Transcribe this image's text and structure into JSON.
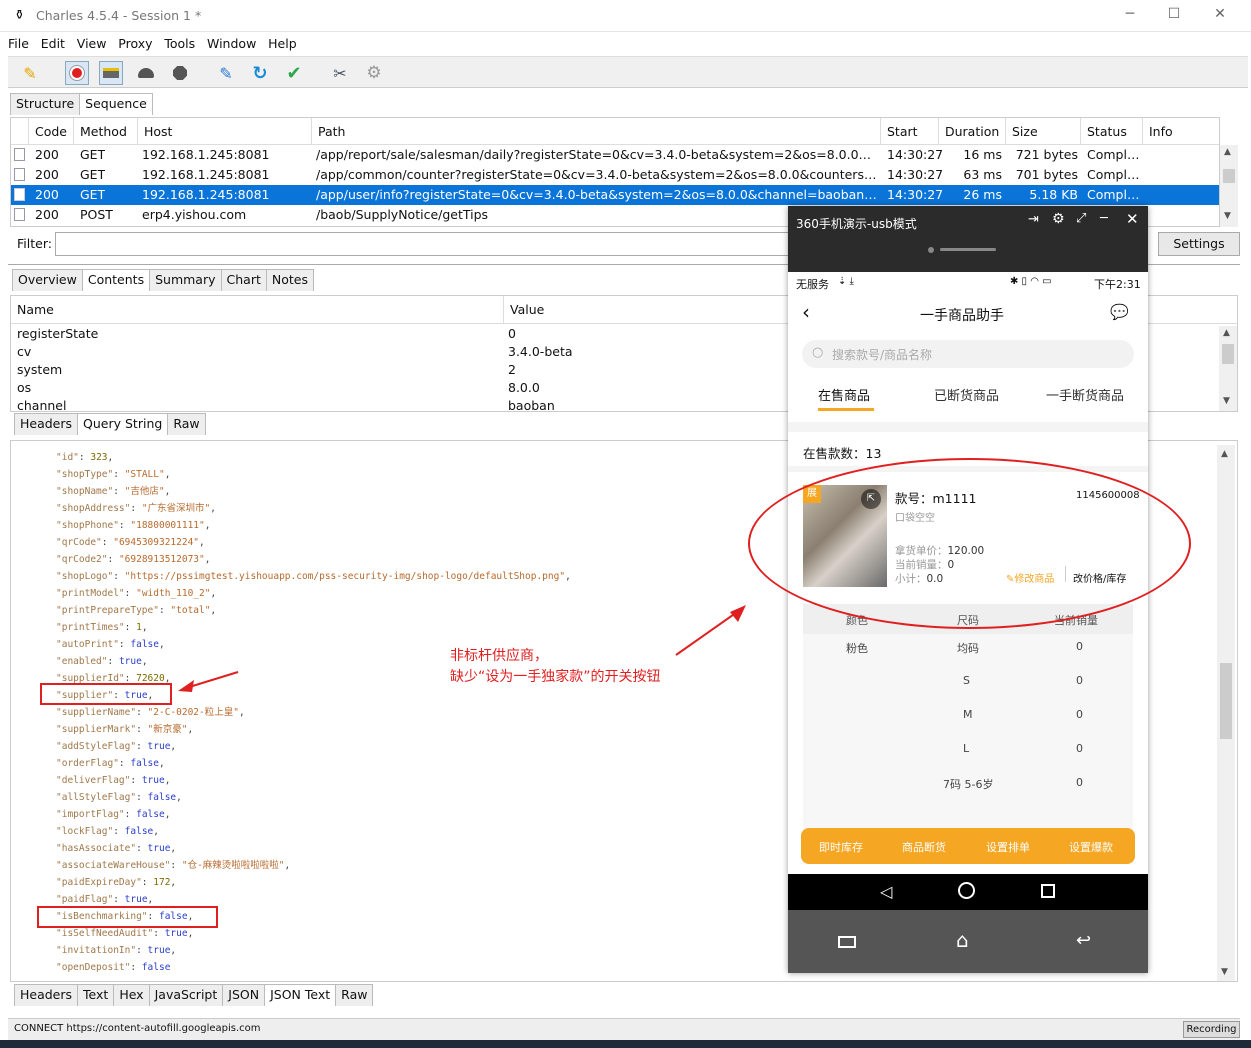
{
  "window": {
    "title": "Charles 4.5.4 - Session 1 *"
  },
  "menu": [
    "File",
    "Edit",
    "View",
    "Proxy",
    "Tools",
    "Window",
    "Help"
  ],
  "toolbar_icons": [
    "broom-icon",
    "record-icon",
    "throttle-icon",
    "turtle-icon",
    "stop-icon",
    "pen-icon",
    "refresh-icon",
    "check-icon",
    "tools-icon",
    "settings-icon"
  ],
  "view_tabs": [
    "Structure",
    "Sequence"
  ],
  "seq_headers": [
    "Code",
    "Method",
    "Host",
    "Path",
    "Start",
    "Duration",
    "Size",
    "Status",
    "Info"
  ],
  "seq_rows": [
    {
      "code": "200",
      "method": "GET",
      "host": "192.168.1.245:8081",
      "path": "/app/report/sale/salesman/daily?registerState=0&cv=3.4.0-beta&system=2&os=8.0.0&channe...",
      "start": "14:30:27",
      "duration": "16 ms",
      "size": "721 bytes",
      "status": "Comple..."
    },
    {
      "code": "200",
      "method": "GET",
      "host": "192.168.1.245:8081",
      "path": "/app/common/counter?registerState=0&cv=3.4.0-beta&system=2&os=8.0.0&counters=order...",
      "start": "14:30:27",
      "duration": "63 ms",
      "size": "701 bytes",
      "status": "Comple..."
    },
    {
      "code": "200",
      "method": "GET",
      "host": "192.168.1.245:8081",
      "path": "/app/user/info?registerState=0&cv=3.4.0-beta&system=2&os=8.0.0&channel=baoban&sign=...",
      "start": "14:30:27",
      "duration": "26 ms",
      "size": "5.18 KB",
      "status": "Comple..."
    },
    {
      "code": "200",
      "method": "POST",
      "host": "erp4.yishou.com",
      "path": "/baob/SupplyNotice/getTips",
      "start": "",
      "duration": "",
      "size": "",
      "status": ""
    }
  ],
  "filter": {
    "label": "Filter:",
    "settings": "Settings"
  },
  "detail_tabs": [
    "Overview",
    "Contents",
    "Summary",
    "Chart",
    "Notes"
  ],
  "param_headers": [
    "Name",
    "Value"
  ],
  "params": [
    {
      "name": "registerState",
      "value": "0"
    },
    {
      "name": "cv",
      "value": "3.4.0-beta"
    },
    {
      "name": "system",
      "value": "2"
    },
    {
      "name": "os",
      "value": "8.0.0"
    },
    {
      "name": "channel",
      "value": "baoban"
    }
  ],
  "req_tabs": [
    "Headers",
    "Query String",
    "Raw"
  ],
  "json_lines": [
    [
      [
        "k",
        "\"id\""
      ],
      [
        "p",
        ": "
      ],
      [
        "n",
        "323"
      ],
      [
        "p",
        ","
      ]
    ],
    [
      [
        "k",
        "\"shopType\""
      ],
      [
        "p",
        ": "
      ],
      [
        "s",
        "\"STALL\""
      ],
      [
        "p",
        ","
      ]
    ],
    [
      [
        "k",
        "\"shopName\""
      ],
      [
        "p",
        ": "
      ],
      [
        "s",
        "\"吉他店\""
      ],
      [
        "p",
        ","
      ]
    ],
    [
      [
        "k",
        "\"shopAddress\""
      ],
      [
        "p",
        ": "
      ],
      [
        "s",
        "\"广东省深圳市\""
      ],
      [
        "p",
        ","
      ]
    ],
    [
      [
        "k",
        "\"shopPhone\""
      ],
      [
        "p",
        ": "
      ],
      [
        "s",
        "\"18800001111\""
      ],
      [
        "p",
        ","
      ]
    ],
    [
      [
        "k",
        "\"qrCode\""
      ],
      [
        "p",
        ": "
      ],
      [
        "s",
        "\"6945309321224\""
      ],
      [
        "p",
        ","
      ]
    ],
    [
      [
        "k",
        "\"qrCode2\""
      ],
      [
        "p",
        ": "
      ],
      [
        "s",
        "\"6928913512073\""
      ],
      [
        "p",
        ","
      ]
    ],
    [
      [
        "k",
        "\"shopLogo\""
      ],
      [
        "p",
        ": "
      ],
      [
        "s",
        "\"https://pssimgtest.yishouapp.com/pss-security-img/shop-logo/defaultShop.png\""
      ],
      [
        "p",
        ","
      ]
    ],
    [
      [
        "k",
        "\"printModel\""
      ],
      [
        "p",
        ": "
      ],
      [
        "s",
        "\"width_110_2\""
      ],
      [
        "p",
        ","
      ]
    ],
    [
      [
        "k",
        "\"printPrepareType\""
      ],
      [
        "p",
        ": "
      ],
      [
        "s",
        "\"total\""
      ],
      [
        "p",
        ","
      ]
    ],
    [
      [
        "k",
        "\"printTimes\""
      ],
      [
        "p",
        ": "
      ],
      [
        "n",
        "1"
      ],
      [
        "p",
        ","
      ]
    ],
    [
      [
        "k",
        "\"autoPrint\""
      ],
      [
        "p",
        ": "
      ],
      [
        "b",
        "false"
      ],
      [
        "p",
        ","
      ]
    ],
    [
      [
        "k",
        "\"enabled\""
      ],
      [
        "p",
        ": "
      ],
      [
        "b",
        "true"
      ],
      [
        "p",
        ","
      ]
    ],
    [
      [
        "k",
        "\"supplierId\""
      ],
      [
        "p",
        ": "
      ],
      [
        "n",
        "72620"
      ],
      [
        "p",
        ","
      ]
    ],
    [
      [
        "k",
        "\"supplier\""
      ],
      [
        "p",
        ": "
      ],
      [
        "b",
        "true"
      ],
      [
        "p",
        ","
      ]
    ],
    [
      [
        "k",
        "\"supplierName\""
      ],
      [
        "p",
        ": "
      ],
      [
        "s",
        "\"2-C-0202-粒上皇\""
      ],
      [
        "p",
        ","
      ]
    ],
    [
      [
        "k",
        "\"supplierMark\""
      ],
      [
        "p",
        ": "
      ],
      [
        "s",
        "\"新京豪\""
      ],
      [
        "p",
        ","
      ]
    ],
    [
      [
        "k",
        "\"addStyleFlag\""
      ],
      [
        "p",
        ": "
      ],
      [
        "b",
        "true"
      ],
      [
        "p",
        ","
      ]
    ],
    [
      [
        "k",
        "\"orderFlag\""
      ],
      [
        "p",
        ": "
      ],
      [
        "b",
        "false"
      ],
      [
        "p",
        ","
      ]
    ],
    [
      [
        "k",
        "\"deliverFlag\""
      ],
      [
        "p",
        ": "
      ],
      [
        "b",
        "true"
      ],
      [
        "p",
        ","
      ]
    ],
    [
      [
        "k",
        "\"allStyleFlag\""
      ],
      [
        "p",
        ": "
      ],
      [
        "b",
        "false"
      ],
      [
        "p",
        ","
      ]
    ],
    [
      [
        "k",
        "\"importFlag\""
      ],
      [
        "p",
        ": "
      ],
      [
        "b",
        "false"
      ],
      [
        "p",
        ","
      ]
    ],
    [
      [
        "k",
        "\"lockFlag\""
      ],
      [
        "p",
        ": "
      ],
      [
        "b",
        "false"
      ],
      [
        "p",
        ","
      ]
    ],
    [
      [
        "k",
        "\"hasAssociate\""
      ],
      [
        "p",
        ": "
      ],
      [
        "b",
        "true"
      ],
      [
        "p",
        ","
      ]
    ],
    [
      [
        "k",
        "\"associateWareHouse\""
      ],
      [
        "p",
        ": "
      ],
      [
        "s",
        "\"仓-麻辣烫啦啦啦啦啦\""
      ],
      [
        "p",
        ","
      ]
    ],
    [
      [
        "k",
        "\"paidExpireDay\""
      ],
      [
        "p",
        ": "
      ],
      [
        "n",
        "172"
      ],
      [
        "p",
        ","
      ]
    ],
    [
      [
        "k",
        "\"paidFlag\""
      ],
      [
        "p",
        ": "
      ],
      [
        "b",
        "true"
      ],
      [
        "p",
        ","
      ]
    ],
    [
      [
        "k",
        "\"isBenchmarking\""
      ],
      [
        "p",
        ": "
      ],
      [
        "b",
        "false"
      ],
      [
        "p",
        ","
      ]
    ],
    [
      [
        "k",
        "\"isSelfNeedAudit\""
      ],
      [
        "p",
        ": "
      ],
      [
        "b",
        "true"
      ],
      [
        "p",
        ","
      ]
    ],
    [
      [
        "k",
        "\"invitationIn\""
      ],
      [
        "p",
        ": "
      ],
      [
        "b",
        "true"
      ],
      [
        "p",
        ","
      ]
    ],
    [
      [
        "k",
        "\"openDeposit\""
      ],
      [
        "p",
        ": "
      ],
      [
        "b",
        "false"
      ]
    ]
  ],
  "resp_tabs": [
    "Headers",
    "Text",
    "Hex",
    "JavaScript",
    "JSON",
    "JSON Text",
    "Raw"
  ],
  "status": {
    "text": "CONNECT https://content-autofill.googleapis.com",
    "recording": "Recording"
  },
  "annotation": {
    "line1": "非标杆供应商，",
    "line2": "缺少“设为一手独家款”的开关按钮"
  },
  "phone": {
    "window_title": "360手机演示-usb模式",
    "status_left": "无服务",
    "status_right": "下午2:31",
    "page_title": "一手商品助手",
    "search_placeholder": "搜索款号/商品名称",
    "tabs": [
      "在售商品",
      "已断货商品",
      "一手断货商品"
    ],
    "count_label": "在售款数：13",
    "product": {
      "badge": "展",
      "style_no": "款号：m1111",
      "code": "1145600008",
      "name": "口袋空空",
      "price_label": "拿货单价：",
      "price": "120.00",
      "sales_label": "当前销量：",
      "sales": "0",
      "subtotal_label": "小计：",
      "subtotal": "0.0",
      "edit": "修改商品",
      "price_stock": "改价格/库存"
    },
    "sku_headers": [
      "颜色",
      "尺码",
      "当前销量"
    ],
    "sku_rows": [
      [
        "粉色",
        "均码",
        "0"
      ],
      [
        "",
        "S",
        "0"
      ],
      [
        "",
        "M",
        "0"
      ],
      [
        "",
        "L",
        "0"
      ],
      [
        "",
        "7码 5-6岁",
        "0"
      ]
    ],
    "actions": [
      "即时库存",
      "商品断货",
      "设置排单",
      "设置爆款"
    ]
  }
}
